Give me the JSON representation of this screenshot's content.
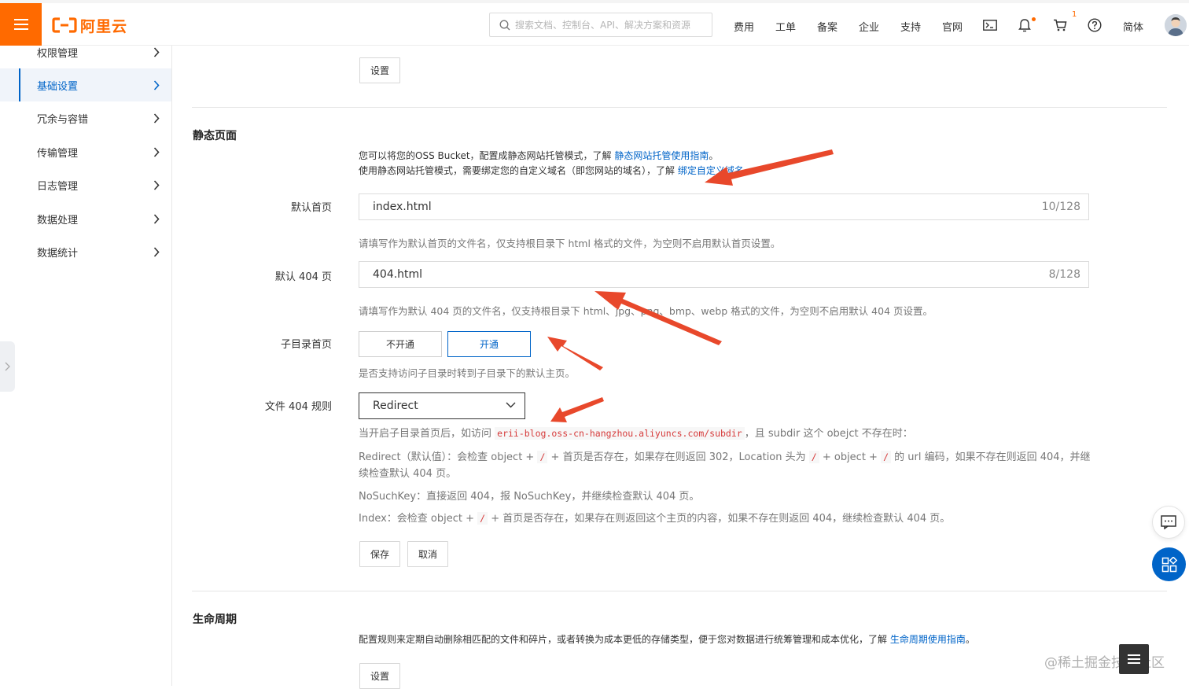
{
  "topbar": {
    "logo_text": "阿里云",
    "search_placeholder": "搜索文档、控制台、API、解决方案和资源",
    "nav": [
      "费用",
      "工单",
      "备案",
      "企业",
      "支持",
      "官网"
    ],
    "notification_count": "1",
    "language": "简体",
    "accent_color": "#ff6a00"
  },
  "sidebar": {
    "items": [
      {
        "label": "权限管理"
      },
      {
        "label": "基础设置",
        "active": true
      },
      {
        "label": "冗余与容错"
      },
      {
        "label": "传输管理"
      },
      {
        "label": "日志管理"
      },
      {
        "label": "数据处理"
      },
      {
        "label": "数据统计"
      }
    ]
  },
  "main": {
    "top_settings_button": "设置",
    "static_page": {
      "title": "静态页面",
      "desc_line1_prefix": "您可以将您的OSS Bucket，配置成静态网站托管模式，了解 ",
      "desc_line1_link": "静态网站托管使用指南",
      "desc_line1_suffix": "。",
      "desc_line2_prefix": "使用静态网站托管模式，需要绑定您的自定义域名（即您网站的域名），了解 ",
      "desc_line2_link": "绑定自定义域名",
      "desc_line2_suffix": "。",
      "default_home_label": "默认首页",
      "default_home_value": "index.html",
      "default_home_count": "10/128",
      "default_home_hint": "请填写作为默认首页的文件名，仅支持根目录下 html 格式的文件，为空则不启用默认首页设置。",
      "default_404_label": "默认 404 页",
      "default_404_value": "404.html",
      "default_404_count": "8/128",
      "default_404_hint": "请填写作为默认 404 页的文件名，仅支持根目录下 html、jpg、png、bmp、webp 格式的文件，为空则不启用默认 404 页设置。",
      "subdir_label": "子目录首页",
      "subdir_off": "不开通",
      "subdir_on": "开通",
      "subdir_hint": "是否支持访问子目录时转到子目录下的默认主页。",
      "rule_label": "文件 404 规则",
      "rule_value": "Redirect",
      "rule_intro_prefix": "当开启子目录首页后，如访问 ",
      "rule_intro_code": "erii-blog.oss-cn-hangzhou.aliyuncs.com/subdir",
      "rule_intro_suffix": "，且 subdir 这个 obejct 不存在时：",
      "redirect_desc_1": "Redirect（默认值）：会检查 object + ",
      "redirect_desc_2": " + 首页是否存在，如果存在则返回 302，Location 头为 ",
      "redirect_desc_3": " + object + ",
      "redirect_desc_4": " 的 url 编码，如果不存在则返回 404，并继续检查默认 404 页。",
      "nosuchkey_desc": "NoSuchKey：直接返回 404，报 NoSuchKey，并继续检查默认 404 页。",
      "index_desc_1": "Index：会检查 object + ",
      "index_desc_2": " + 首页是否存在，如果存在则返回这个主页的内容，如果不存在则返回 404，继续检查默认 404 页。",
      "slash": "/",
      "save_button": "保存",
      "cancel_button": "取消"
    },
    "lifecycle": {
      "title": "生命周期",
      "desc_prefix": "配置规则来定期自动删除相匹配的文件和碎片，或者转换为成本更低的存储类型，便于您对数据进行统筹管理和成本优化，了解 ",
      "desc_link": "生命周期使用指南",
      "desc_suffix": "。",
      "settings_button": "设置"
    }
  },
  "watermark": "@稀土掘金技术社区",
  "colors": {
    "link": "#0064c8",
    "annotation_arrow": "#e8482b"
  }
}
